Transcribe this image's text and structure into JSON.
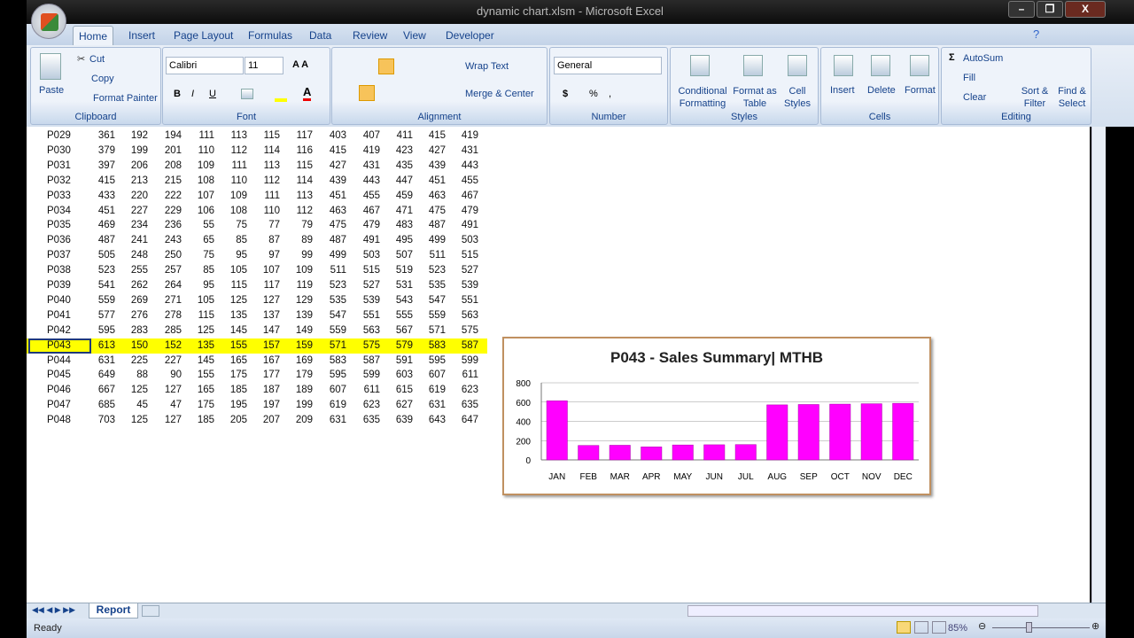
{
  "window": {
    "title": "dynamic chart.xlsm - Microsoft Excel"
  },
  "tabs": [
    "Home",
    "Insert",
    "Page Layout",
    "Formulas",
    "Data",
    "Review",
    "View",
    "Developer"
  ],
  "ribbon": {
    "clipboard": {
      "label": "Clipboard",
      "paste": "Paste",
      "cut": "Cut",
      "copy": "Copy",
      "format_painter": "Format Painter"
    },
    "font": {
      "label": "Font",
      "font_name": "Calibri",
      "font_size": "11",
      "bold": "B",
      "italic": "I",
      "underline": "U"
    },
    "alignment": {
      "label": "Alignment",
      "wrap_text": "Wrap Text",
      "merge_center": "Merge & Center"
    },
    "number": {
      "label": "Number",
      "format": "General",
      "currency": "$",
      "percent": "%",
      "comma": ","
    },
    "styles": {
      "label": "Styles",
      "conditional": "Conditional Formatting",
      "format_table": "Format as Table",
      "cell_styles": "Cell Styles"
    },
    "cells": {
      "label": "Cells",
      "insert": "Insert",
      "delete": "Delete",
      "format": "Format"
    },
    "editing": {
      "label": "Editing",
      "autosum": "AutoSum",
      "fill": "Fill",
      "clear": "Clear",
      "sort_filter": "Sort & Filter",
      "find_select": "Find & Select"
    }
  },
  "rows": [
    [
      "P029",
      361,
      192,
      194,
      111,
      113,
      115,
      117,
      403,
      407,
      411,
      415,
      419
    ],
    [
      "P030",
      379,
      199,
      201,
      110,
      112,
      114,
      116,
      415,
      419,
      423,
      427,
      431
    ],
    [
      "P031",
      397,
      206,
      208,
      109,
      111,
      113,
      115,
      427,
      431,
      435,
      439,
      443
    ],
    [
      "P032",
      415,
      213,
      215,
      108,
      110,
      112,
      114,
      439,
      443,
      447,
      451,
      455
    ],
    [
      "P033",
      433,
      220,
      222,
      107,
      109,
      111,
      113,
      451,
      455,
      459,
      463,
      467
    ],
    [
      "P034",
      451,
      227,
      229,
      106,
      108,
      110,
      112,
      463,
      467,
      471,
      475,
      479
    ],
    [
      "P035",
      469,
      234,
      236,
      55,
      75,
      77,
      79,
      475,
      479,
      483,
      487,
      491
    ],
    [
      "P036",
      487,
      241,
      243,
      65,
      85,
      87,
      89,
      487,
      491,
      495,
      499,
      503
    ],
    [
      "P037",
      505,
      248,
      250,
      75,
      95,
      97,
      99,
      499,
      503,
      507,
      511,
      515
    ],
    [
      "P038",
      523,
      255,
      257,
      85,
      105,
      107,
      109,
      511,
      515,
      519,
      523,
      527
    ],
    [
      "P039",
      541,
      262,
      264,
      95,
      115,
      117,
      119,
      523,
      527,
      531,
      535,
      539
    ],
    [
      "P040",
      559,
      269,
      271,
      105,
      125,
      127,
      129,
      535,
      539,
      543,
      547,
      551
    ],
    [
      "P041",
      577,
      276,
      278,
      115,
      135,
      137,
      139,
      547,
      551,
      555,
      559,
      563
    ],
    [
      "P042",
      595,
      283,
      285,
      125,
      145,
      147,
      149,
      559,
      563,
      567,
      571,
      575
    ],
    [
      "P043",
      613,
      150,
      152,
      135,
      155,
      157,
      159,
      571,
      575,
      579,
      583,
      587
    ],
    [
      "P044",
      631,
      225,
      227,
      145,
      165,
      167,
      169,
      583,
      587,
      591,
      595,
      599
    ],
    [
      "P045",
      649,
      88,
      90,
      155,
      175,
      177,
      179,
      595,
      599,
      603,
      607,
      611
    ],
    [
      "P046",
      667,
      125,
      127,
      165,
      185,
      187,
      189,
      607,
      611,
      615,
      619,
      623
    ],
    [
      "P047",
      685,
      45,
      47,
      175,
      195,
      197,
      199,
      619,
      623,
      627,
      631,
      635
    ],
    [
      "P048",
      703,
      125,
      127,
      185,
      205,
      207,
      209,
      631,
      635,
      639,
      643,
      647
    ]
  ],
  "selected_row": "P043",
  "highlight_color": "#ffff00",
  "chart_data": {
    "type": "bar",
    "title": "P043 - Sales Summary| MTHB",
    "categories": [
      "JAN",
      "FEB",
      "MAR",
      "APR",
      "MAY",
      "JUN",
      "JUL",
      "AUG",
      "SEP",
      "OCT",
      "NOV",
      "DEC"
    ],
    "values": [
      613,
      150,
      152,
      135,
      155,
      157,
      159,
      571,
      575,
      579,
      583,
      587
    ],
    "yticks": [
      0,
      200,
      400,
      600,
      800
    ],
    "ylim": [
      0,
      800
    ],
    "grid": true,
    "bar_color": "#ff00ff"
  },
  "sheet_tab": "Report",
  "status": {
    "ready": "Ready",
    "zoom": "85%"
  }
}
